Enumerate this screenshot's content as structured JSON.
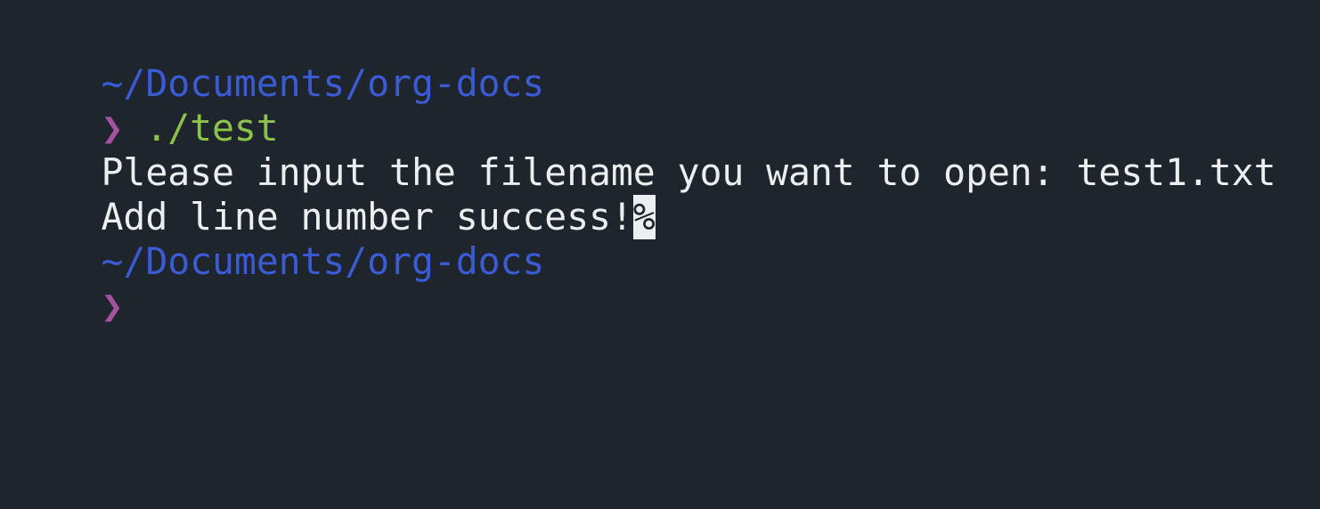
{
  "terminal": {
    "lines": [
      {
        "type": "path",
        "text": "~/Documents/org-docs"
      },
      {
        "type": "prompt",
        "prompt_char": "❯",
        "command": "./test"
      },
      {
        "type": "output",
        "text": "Please input the filename you want to open: test1.txt"
      },
      {
        "type": "output_eol",
        "text": "Add line number success!",
        "eol_marker": "%"
      },
      {
        "type": "path",
        "text": "~/Documents/org-docs"
      },
      {
        "type": "prompt",
        "prompt_char": "❯",
        "command": ""
      }
    ]
  },
  "colors": {
    "background": "#1e252c",
    "path": "#3a5bd4",
    "prompt_char": "#a4519f",
    "command": "#8bc34a",
    "output": "#eceeef"
  }
}
